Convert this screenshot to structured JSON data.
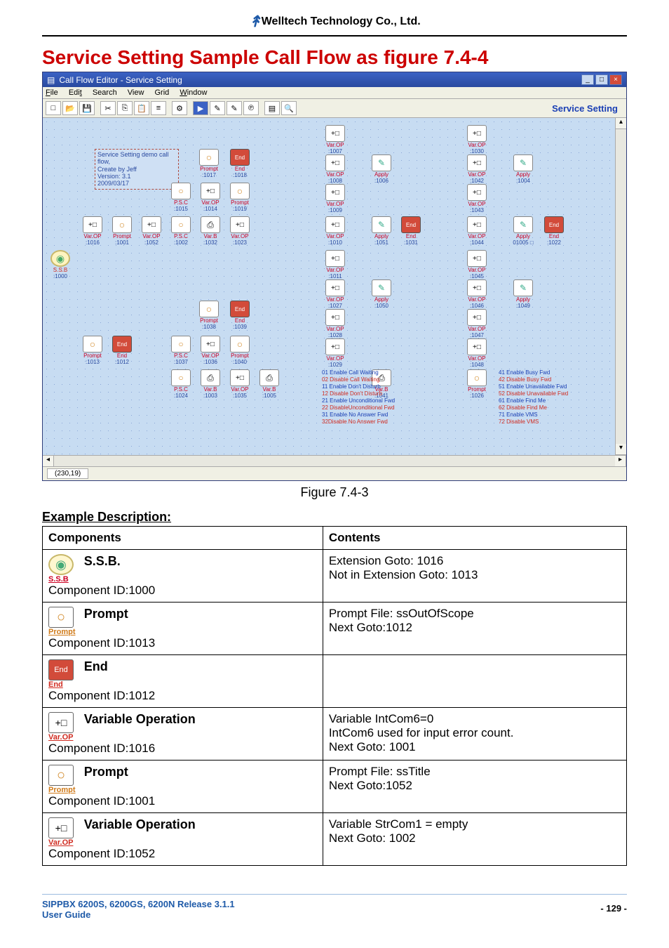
{
  "header": {
    "company": "Welltech Technology Co., Ltd."
  },
  "section": {
    "title": "Service Setting Sample Call Flow as figure 7.4-4"
  },
  "editor": {
    "title": "Call Flow Editor - Service Setting",
    "menus": {
      "file": "File",
      "edit": "Edit",
      "search": "Search",
      "view": "View",
      "grid": "Grid",
      "window": "Window"
    },
    "service_label": "Service Setting",
    "comment": {
      "l1": "Service Setting demo call flow,",
      "l2": "Create by Jeff",
      "l3": "Version: 3.1",
      "l4": "2009/03/17"
    },
    "flow_comments_left": {
      "c01": "01 Enable Call Waiting",
      "c02": "02 Disable Call Waiting",
      "c11": "11 Enable Don't Disturb",
      "c12": "12 Disable Don't Disturb",
      "c21": "21 Enable Unconditional Fwd",
      "c22": "22 DisableUnconditional Fwd",
      "c31": "31 Enable No Answer Fwd",
      "c32": "32Disable No Answer Fwd"
    },
    "flow_comments_right": {
      "c41": "41 Enable Busy Fwd",
      "c42": "42 Disable Busy Fwd",
      "c51": "51 Enable Unavailable Fwd",
      "c52": "52 Disable Unavailable Fwd",
      "c61": "61 Enable Find Me",
      "c62": "62 Disable Find Me",
      "c71": "71 Enable VMS",
      "c72": "72 Disable VMS"
    },
    "nodes": {
      "n1000": {
        "id": ":1000",
        "lab": "S.S.B"
      },
      "n1016": {
        "id": ":1016",
        "lab": "Var.OP"
      },
      "n1001": {
        "id": ":1001",
        "lab": "Prompt"
      },
      "n1052": {
        "id": ":1052",
        "lab": "Var.OP"
      },
      "n1002": {
        "id": ":1002",
        "lab": "P.S.C"
      },
      "n1032": {
        "id": ":1032",
        "lab": "Var.B"
      },
      "n1023": {
        "id": ":1023",
        "lab": "Var.OP"
      },
      "n1015": {
        "id": ":1015",
        "lab": "P.S.C"
      },
      "n1014": {
        "id": ":1014",
        "lab": "Var.OP"
      },
      "n1019": {
        "id": ":1019",
        "lab": "Prompt"
      },
      "n1017": {
        "id": ":1017",
        "lab": "Prompt"
      },
      "n1018": {
        "id": ":1018",
        "lab": "End"
      },
      "n1013": {
        "id": ":1013",
        "lab": "Prompt"
      },
      "n1012": {
        "id": ":1012",
        "lab": "End"
      },
      "n1037": {
        "id": ":1037",
        "lab": "P.S.C"
      },
      "n1036": {
        "id": ":1036",
        "lab": "Var.OP"
      },
      "n1040": {
        "id": ":1040",
        "lab": "Prompt"
      },
      "n1038": {
        "id": ":1038",
        "lab": "Prompt"
      },
      "n1039": {
        "id": ":1039",
        "lab": "End"
      },
      "n1024": {
        "id": ":1024",
        "lab": "P.S.C"
      },
      "n1003": {
        "id": ":1003",
        "lab": "Var.B"
      },
      "n1035": {
        "id": ":1035",
        "lab": "Var.OP"
      },
      "n1005": {
        "id": ":1005",
        "lab": "Var.B"
      },
      "n1007": {
        "id": ":1007",
        "lab": "Var.OP"
      },
      "n1008": {
        "id": ":1008",
        "lab": "Var.OP"
      },
      "n1009": {
        "id": ":1009",
        "lab": "Var.OP"
      },
      "n1010": {
        "id": ":1010",
        "lab": "Var.OP"
      },
      "n1011": {
        "id": ":1011",
        "lab": "Var.OP"
      },
      "n1027": {
        "id": ":1027",
        "lab": "Var.OP"
      },
      "n1028": {
        "id": ":1028",
        "lab": "Var.OP"
      },
      "n1029": {
        "id": ":1029",
        "lab": "Var.OP"
      },
      "n1006": {
        "id": ":1006",
        "lab": "Apply"
      },
      "n1051": {
        "id": ":1051",
        "lab": "Apply"
      },
      "n1031": {
        "id": ":1031",
        "lab": "End"
      },
      "n1050": {
        "id": ":1050",
        "lab": "Apply"
      },
      "n1041": {
        "id": ":1041",
        "lab": "Var.B"
      },
      "n1030": {
        "id": ":1030",
        "lab": "Var.OP"
      },
      "n1042": {
        "id": ":1042",
        "lab": "Var.OP"
      },
      "n1043": {
        "id": ":1043",
        "lab": "Var.OP"
      },
      "n1044": {
        "id": ":1044",
        "lab": "Var.OP"
      },
      "n1045": {
        "id": ":1045",
        "lab": "Var.OP"
      },
      "n1046": {
        "id": ":1046",
        "lab": "Var.OP"
      },
      "n1047": {
        "id": ":1047",
        "lab": "Var.OP"
      },
      "n1048": {
        "id": ":1048",
        "lab": "Var.OP"
      },
      "n1004": {
        "id": ":1004",
        "lab": "Apply"
      },
      "n1005b": {
        "id": ":1005",
        "lab": "Apply"
      },
      "n1022": {
        "id": ":1022",
        "lab": "End"
      },
      "n1049": {
        "id": ":1049",
        "lab": "Apply"
      },
      "n1026": {
        "id": ":1026",
        "lab": "Prompt"
      }
    },
    "status_coord": "(230,19)"
  },
  "figure_caption": "Figure 7.4-3",
  "example_title": "Example Description:",
  "table": {
    "head": {
      "c1": "Components",
      "c2": "Contents"
    },
    "rows": [
      {
        "comp_name": "S.S.B.",
        "comp_id": "Component ID:1000",
        "icon": "ssb",
        "icon_cap": "S.S.B",
        "contents": [
          "Extension Goto: 1016",
          "Not in Extension Goto: 1013"
        ]
      },
      {
        "comp_name": "Prompt",
        "comp_id": "Component ID:1013",
        "icon": "prompt",
        "icon_cap": "Prompt",
        "contents": [
          "Prompt File: ssOutOfScope",
          "Next Goto:1012"
        ]
      },
      {
        "comp_name": "End",
        "comp_id": "Component ID:1012",
        "icon": "end",
        "icon_cap": "End",
        "contents": []
      },
      {
        "comp_name": "Variable Operation",
        "comp_id": "Component ID:1016",
        "icon": "varop",
        "icon_cap": "Var.OP",
        "contents": [
          "Variable IntCom6=0",
          "IntCom6 used for input error count.",
          "Next Goto: 1001"
        ]
      },
      {
        "comp_name": "Prompt",
        "comp_id": "Component ID:1001",
        "icon": "prompt",
        "icon_cap": "Prompt",
        "contents": [
          "Prompt File: ssTitle",
          "Next Goto:1052"
        ]
      },
      {
        "comp_name": "Variable Operation",
        "comp_id": "Component ID:1052",
        "icon": "varop",
        "icon_cap": "Var.OP",
        "contents": [
          "Variable StrCom1 = empty",
          "Next Goto: 1002"
        ]
      }
    ]
  },
  "footer": {
    "l1": "SIPPBX 6200S, 6200GS, 6200N Release 3.1.1",
    "l2": "User Guide",
    "page": "- 129 -"
  }
}
